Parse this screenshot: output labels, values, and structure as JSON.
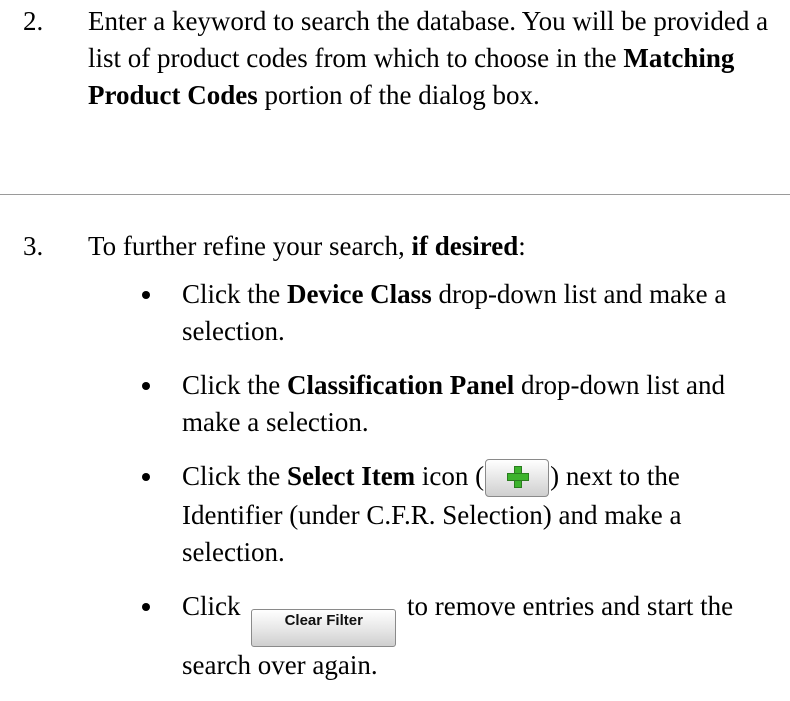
{
  "step2": {
    "number": "2.",
    "text_before": "Enter a keyword to search the database.  You will be provided a list of product codes from which to choose in the ",
    "bold": "Matching Product Codes",
    "text_after": " portion of the dialog box."
  },
  "step3": {
    "number": "3.",
    "intro_before": "To further refine your search, ",
    "intro_bold": "if desired",
    "intro_after": ":",
    "bullets": [
      {
        "before": "Click the ",
        "bold": "Device Class",
        "after": " drop-down list and make a selection."
      },
      {
        "before": "Click the ",
        "bold": "Classification Panel",
        "after": " drop-down list and make a selection."
      },
      {
        "before": "Click the ",
        "bold": "Select Item",
        "mid": " icon (",
        "after": ") next to the Identifier (under C.F.R. Selection) and make a selection."
      },
      {
        "before": "Click ",
        "button_label": "Clear Filter",
        "after": " to remove entries and start the search over again."
      }
    ]
  },
  "icons": {
    "select_item": "green-plus-icon"
  }
}
